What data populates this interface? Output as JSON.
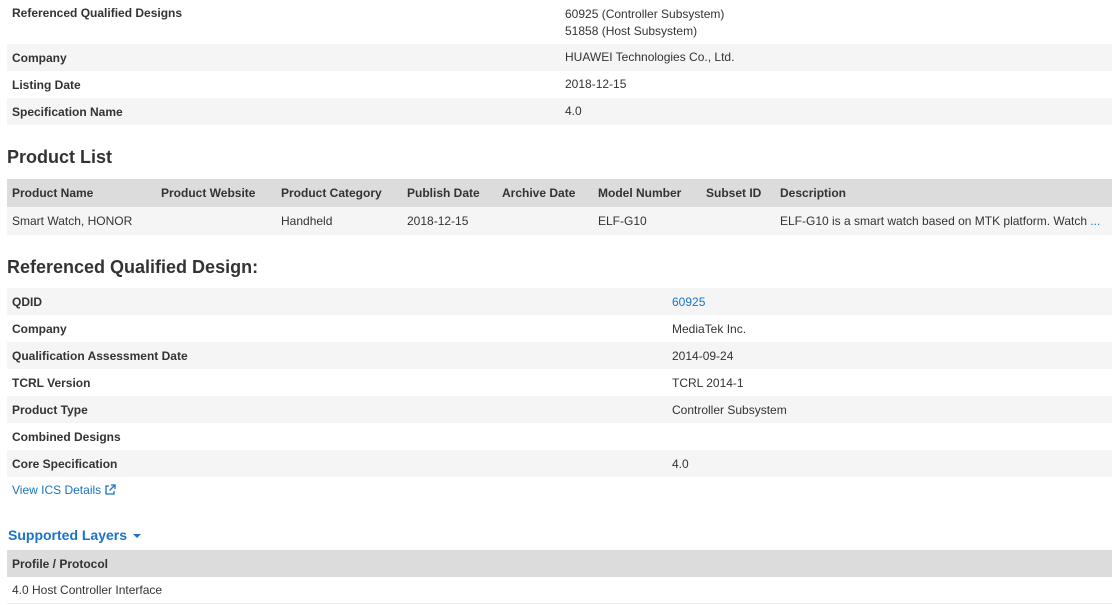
{
  "top_info": {
    "rows": [
      {
        "key": "Referenced Qualified Designs",
        "value_lines": [
          "60925 (Controller Subsystem)",
          "51858 (Host Subsystem)"
        ]
      },
      {
        "key": "Company",
        "value": "HUAWEI Technologies Co., Ltd."
      },
      {
        "key": "Listing Date",
        "value": "2018-12-15"
      },
      {
        "key": "Specification Name",
        "value": "4.0"
      }
    ]
  },
  "product_list": {
    "title": "Product List",
    "headers": [
      "Product Name",
      "Product Website",
      "Product Category",
      "Publish Date",
      "Archive Date",
      "Model Number",
      "Subset ID",
      "Description"
    ],
    "rows": [
      {
        "product_name": "Smart Watch, HONOR",
        "product_website": "",
        "product_category": "Handheld",
        "publish_date": "2018-12-15",
        "archive_date": "",
        "model_number": "ELF-G10",
        "subset_id": "",
        "description": "ELF-G10 is a smart watch based on MTK platform. Watch",
        "more": "..."
      }
    ]
  },
  "referenced_design": {
    "title": "Referenced Qualified Design:",
    "rows": [
      {
        "key": "QDID",
        "value": "60925",
        "is_link": true
      },
      {
        "key": "Company",
        "value": "MediaTek Inc."
      },
      {
        "key": "Qualification Assessment Date",
        "value": "2014-09-24"
      },
      {
        "key": "TCRL Version",
        "value": "TCRL 2014-1"
      },
      {
        "key": "Product Type",
        "value": "Controller Subsystem"
      },
      {
        "key": "Combined Designs",
        "value": ""
      },
      {
        "key": "Core Specification",
        "value": "4.0"
      }
    ],
    "ics_link": "View ICS Details",
    "ics_icon": "external-link-icon"
  },
  "supported_layers": {
    "toggle_label": "Supported Layers",
    "header": "Profile / Protocol",
    "rows": [
      "4.0 Host Controller Interface"
    ]
  },
  "colors": {
    "link": "#1a73c8",
    "header_bg": "#dcdcdc",
    "shaded_row": "#f5f5f5",
    "text": "#333333"
  }
}
